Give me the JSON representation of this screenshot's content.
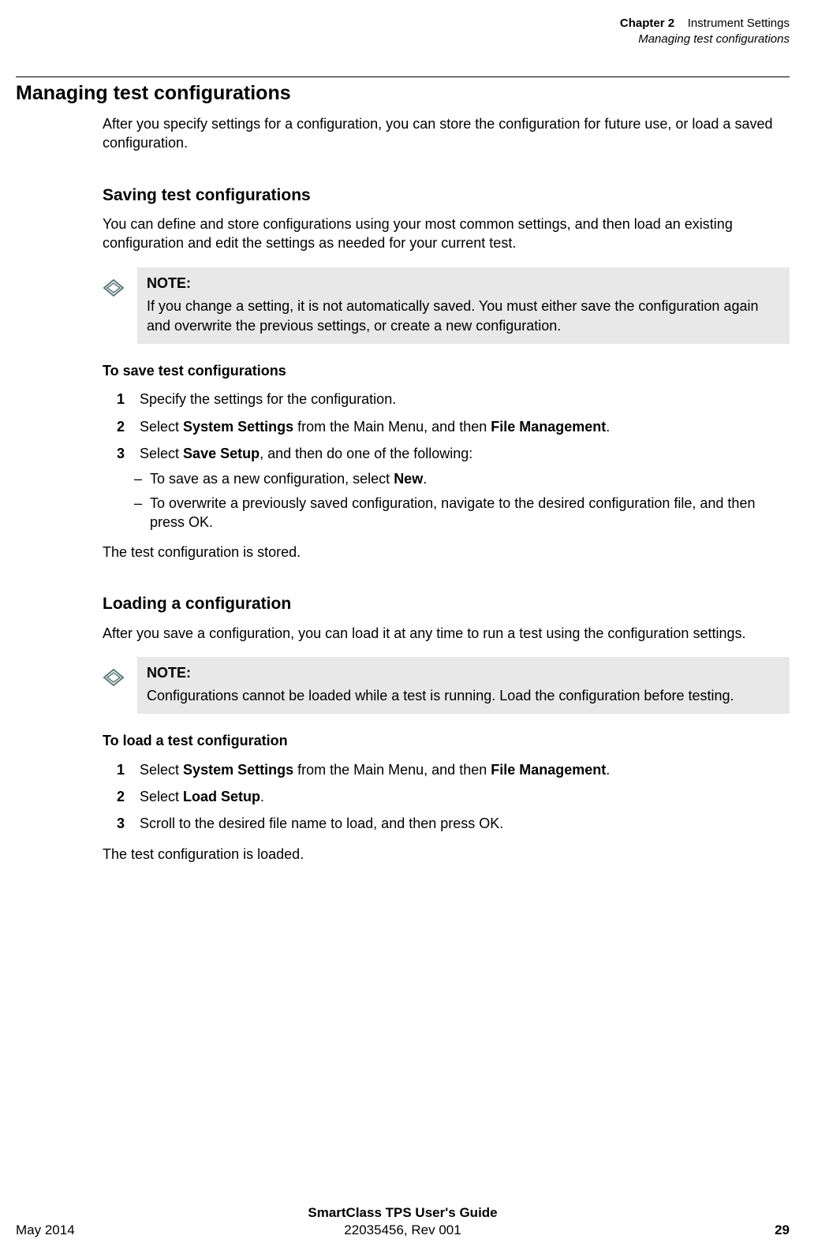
{
  "runningHeader": {
    "chapterLabel": "Chapter 2",
    "chapterTitle": "Instrument Settings",
    "sectionTitle": "Managing test configurations"
  },
  "heading1": "Managing test configurations",
  "intro": "After you specify settings for a configuration, you can store the configuration for future use, or load a saved configuration.",
  "saving": {
    "heading": "Saving test configurations",
    "intro": "You can define and store configurations using your most common settings, and then load an existing configuration and edit the settings as needed for your current test.",
    "noteLabel": "NOTE:",
    "noteText": "If you change a setting, it is not automatically saved. You must either save the configuration again and overwrite the previous settings, or create a new configuration.",
    "procTitle": "To save test configurations",
    "step1": {
      "num": "1",
      "text": "Specify the settings for the configuration."
    },
    "step2": {
      "num": "2",
      "prefix": "Select ",
      "b1": "System Settings",
      "mid": " from the Main Menu, and then ",
      "b2": "File Management",
      "suffix": "."
    },
    "step3": {
      "num": "3",
      "prefix": "Select ",
      "b1": "Save Setup",
      "suffix": ", and then do one of the following:"
    },
    "sub1": {
      "prefix": "To save as a new configuration, select ",
      "b1": "New",
      "suffix": "."
    },
    "sub2": "To overwrite a previously saved configuration, navigate to the desired configuration file, and then press OK.",
    "result": "The test configuration is stored."
  },
  "loading": {
    "heading": "Loading a configuration",
    "intro": "After you save a configuration, you can load it at any time to run a test using the configuration settings.",
    "noteLabel": "NOTE:",
    "noteText": "Configurations cannot be loaded while a test is running. Load the configuration before testing.",
    "procTitle": "To load a test configuration",
    "step1": {
      "num": "1",
      "prefix": "Select ",
      "b1": "System Settings",
      "mid": " from the Main Menu, and then ",
      "b2": "File Management",
      "suffix": "."
    },
    "step2": {
      "num": "2",
      "prefix": "Select ",
      "b1": "Load Setup",
      "suffix": "."
    },
    "step3": {
      "num": "3",
      "text": "Scroll to the desired file name to load, and then press OK."
    },
    "result": "The test configuration is loaded."
  },
  "footer": {
    "guideTitle": "SmartClass TPS User's Guide",
    "date": "May 2014",
    "docNumber": "22035456, Rev 001",
    "pageNum": "29"
  }
}
